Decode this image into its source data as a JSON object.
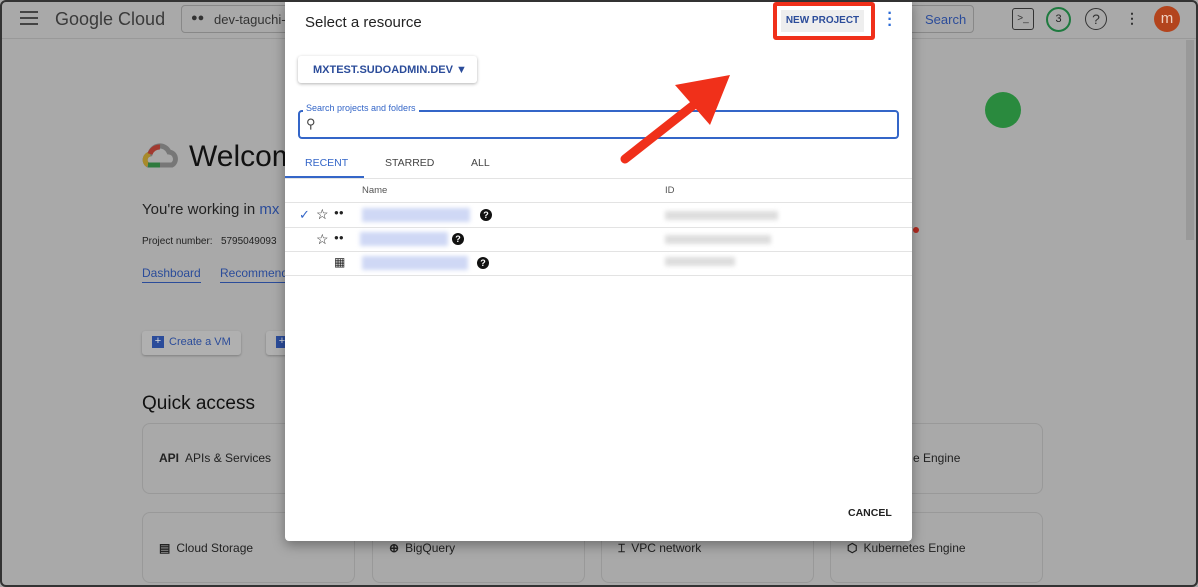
{
  "header": {
    "logo": "Google Cloud",
    "project": "dev-taguchi-bo",
    "search_label": "Search",
    "notifications": "3",
    "avatar": "m"
  },
  "page": {
    "welcome": "Welcom",
    "working_in": "You're working in",
    "working_project": "mx",
    "project_number_label": "Project number:",
    "project_number": "5795049093",
    "links": [
      "Dashboard",
      "Recommend"
    ],
    "buttons": [
      "Create a VM",
      ""
    ],
    "quick_access": "Quick access",
    "cards": [
      {
        "icon": "API",
        "label": "APIs & Services"
      },
      {
        "label": "e Engine"
      },
      {
        "label": "Cloud Storage"
      },
      {
        "label": "BigQuery"
      },
      {
        "label": "VPC network"
      },
      {
        "label": "Kubernetes Engine"
      }
    ]
  },
  "dialog": {
    "title": "Select a resource",
    "new_project": "NEW PROJECT",
    "org": "MXTEST.SUDOADMIN.DEV",
    "search_label": "Search projects and folders",
    "search_value": "",
    "tabs": [
      "RECENT",
      "STARRED",
      "ALL"
    ],
    "active_tab": "RECENT",
    "columns": [
      "Name",
      "ID"
    ],
    "cancel": "CANCEL"
  },
  "colors": {
    "accent": "#3466c8",
    "highlight": "#f0301a"
  }
}
